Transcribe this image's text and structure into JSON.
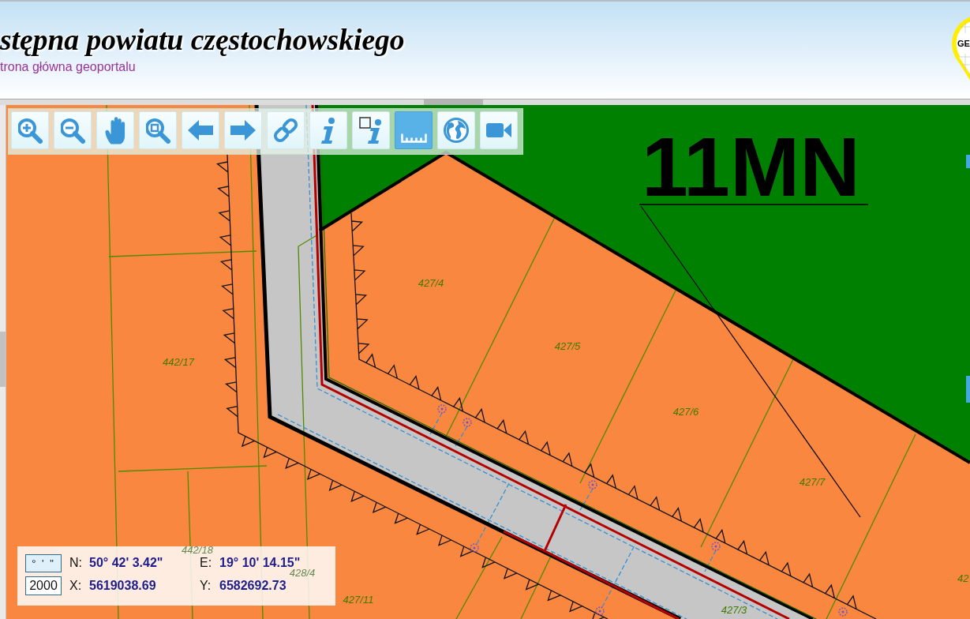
{
  "header": {
    "title": "stępna powiatu częstochowskiego",
    "home_link": "trona główna geoportalu",
    "logo_text": "GE"
  },
  "toolbar": {
    "tools": [
      {
        "selected": false
      },
      {
        "selected": false
      },
      {
        "selected": false
      },
      {
        "selected": false
      },
      {
        "selected": false
      },
      {
        "selected": false
      },
      {
        "selected": false
      },
      {
        "selected": false
      },
      {
        "selected": false
      },
      {
        "selected": true
      },
      {
        "selected": false
      },
      {
        "selected": false
      }
    ]
  },
  "map": {
    "zone_label": "11MN",
    "parcel_labels": [
      "427/4",
      "427/5",
      "427/6",
      "427/7",
      "442/17",
      "442/18",
      "428/4",
      "427/11",
      "427/3",
      "42"
    ]
  },
  "coordinates": {
    "format_button": "° ' \"",
    "system_field": "2000",
    "readings": [
      {
        "label": "N:",
        "value": "50° 42' 3.42\""
      },
      {
        "label": "E:",
        "value": "19° 10' 14.15\""
      },
      {
        "label": "X:",
        "value": "5619038.69"
      },
      {
        "label": "Y:",
        "value": "6582692.73"
      }
    ]
  }
}
